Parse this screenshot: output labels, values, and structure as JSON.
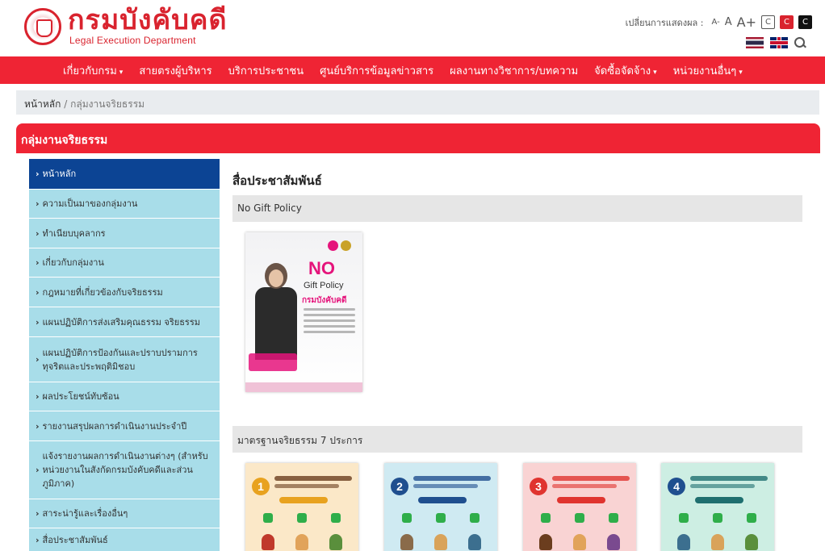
{
  "header": {
    "logo_th": "กรมบังคับคดี",
    "logo_en": "Legal Execution Department",
    "display_label": "เปลี่ยนการแสดงผล :",
    "font_small": "A-",
    "font_normal": "A",
    "font_large": "A+",
    "contrast_normal": "C",
    "contrast_red": "C",
    "contrast_black": "C"
  },
  "nav": {
    "items": [
      {
        "label": "เกี่ยวกับกรม",
        "dropdown": true
      },
      {
        "label": "สายตรงผู้บริหาร",
        "dropdown": false
      },
      {
        "label": "บริการประชาชน",
        "dropdown": false
      },
      {
        "label": "ศูนย์บริการข้อมูลข่าวสาร",
        "dropdown": false
      },
      {
        "label": "ผลงานทางวิชาการ/บทความ",
        "dropdown": false
      },
      {
        "label": "จัดซื้อจัดจ้าง",
        "dropdown": true
      },
      {
        "label": "หน่วยงานอื่นๆ",
        "dropdown": true
      }
    ],
    "caret": "▾"
  },
  "breadcrumb": {
    "home": "หน้าหลัก",
    "separator": "/",
    "current": "กลุ่มงานจริยธรรม"
  },
  "section_title": "กลุ่มงานจริยธรรม",
  "sidebar": {
    "arrow": "›",
    "items": [
      {
        "label": "หน้าหลัก",
        "active": true
      },
      {
        "label": "ความเป็นมาของกลุ่มงาน"
      },
      {
        "label": "ทำเนียบบุคลากร"
      },
      {
        "label": "เกี่ยวกับกลุ่มงาน"
      },
      {
        "label": "กฎหมายที่เกี่ยวข้องกับจริยธรรม"
      },
      {
        "label": "แผนปฏิบัติการส่งเสริมคุณธรรม จริยธรรม"
      },
      {
        "label": "แผนปฏิบัติการป้องกันและปราบปรามการทุจริตและประพฤติมิชอบ"
      },
      {
        "label": "ผลประโยชน์ทับซ้อน"
      },
      {
        "label": "รายงานสรุปผลการดำเนินงานประจำปี"
      },
      {
        "label": "แจ้งรายงานผลการดำเนินงานต่างๆ (สำหรับหน่วยงานในสังกัดกรมบังคับคดีและส่วนภูมิภาค)"
      },
      {
        "label": "สาระน่ารู้และเรื่องอื่นๆ"
      },
      {
        "label": "สื่อประชาสัมพันธ์"
      }
    ]
  },
  "content": {
    "title": "สื่อประชาสัมพันธ์",
    "sections": [
      {
        "heading": "No Gift Policy"
      },
      {
        "heading": "มาตรฐานจริยธรรม 7 ประการ"
      }
    ],
    "poster": {
      "no": "NO",
      "gift_policy": "Gift Policy",
      "brand": "กรมบังคับคดี"
    },
    "ethics_cards": [
      {
        "num": "1",
        "color": "#e8a21f"
      },
      {
        "num": "2",
        "color": "#1f4f8f"
      },
      {
        "num": "3",
        "color": "#e0342f"
      },
      {
        "num": "4",
        "color": "#1f4f8f"
      }
    ]
  },
  "colors": {
    "brand_red": "#ef2434",
    "active_blue": "#0c4494",
    "sidebar_bg": "#a8dde9"
  }
}
